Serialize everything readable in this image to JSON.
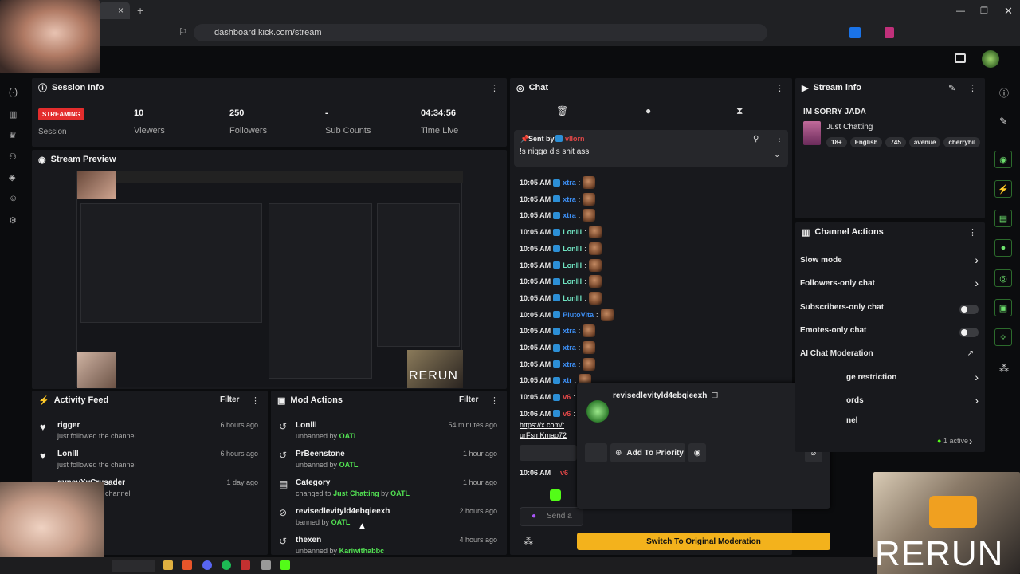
{
  "browser": {
    "url": "dashboard.kick.com/stream",
    "tab_close": "×",
    "tab_new": "+"
  },
  "session": {
    "title": "Session Info",
    "badge": "STREAMING",
    "session_label": "Session",
    "stats": [
      {
        "value": "10",
        "label": "Viewers"
      },
      {
        "value": "250",
        "label": "Followers"
      },
      {
        "value": "-",
        "label": "Sub Counts"
      },
      {
        "value": "04:34:56",
        "label": "Time Live"
      }
    ]
  },
  "preview": {
    "title": "Stream Preview",
    "rerun": "RERUN"
  },
  "activity": {
    "title": "Activity Feed",
    "filter": "Filter",
    "items": [
      {
        "name": "rigger",
        "desc": "just followed the channel",
        "time": "6 hours ago"
      },
      {
        "name": "Lonlll",
        "desc": "just followed the channel",
        "time": "6 hours ago"
      },
      {
        "name": "gypsyXvCrusader",
        "desc": "channel",
        "time": "1 day ago"
      }
    ]
  },
  "mod": {
    "title": "Mod Actions",
    "filter": "Filter",
    "items": [
      {
        "name": "Lonlll",
        "desc": "unbanned by",
        "by": "OATL",
        "time": "54 minutes ago"
      },
      {
        "name": "PrBeenstone",
        "desc": "unbanned by",
        "by": "OATL",
        "time": "1 hour ago"
      },
      {
        "name": "Category",
        "desc": "changed to",
        "cat": "Just Chatting",
        "by_word": "by",
        "by": "OATL",
        "time": "1 hour ago"
      },
      {
        "name": "revisedlevityld4ebqieexh",
        "desc": "banned by",
        "by": "OATL",
        "time": "2 hours ago"
      },
      {
        "name": "thexen",
        "desc": "unbanned by",
        "by": "Kariwithabbc",
        "time": "4 hours ago"
      }
    ]
  },
  "chat": {
    "title": "Chat",
    "pinned_by": "Sent by",
    "pinned_user": "vllorn",
    "pinned_msg": "!s nigga dis shit ass",
    "lines": [
      {
        "time": "10:05 AM",
        "user": "xtra",
        "color": "#3d8ef2"
      },
      {
        "time": "10:05 AM",
        "user": "xtra",
        "color": "#3d8ef2"
      },
      {
        "time": "10:05 AM",
        "user": "xtra",
        "color": "#3d8ef2"
      },
      {
        "time": "10:05 AM",
        "user": "Lonlll",
        "color": "#6fe3c1"
      },
      {
        "time": "10:05 AM",
        "user": "Lonlll",
        "color": "#6fe3c1"
      },
      {
        "time": "10:05 AM",
        "user": "Lonlll",
        "color": "#6fe3c1"
      },
      {
        "time": "10:05 AM",
        "user": "Lonlll",
        "color": "#6fe3c1"
      },
      {
        "time": "10:05 AM",
        "user": "Lonlll",
        "color": "#6fe3c1"
      },
      {
        "time": "10:05 AM",
        "user": "PlutoVita",
        "color": "#3d8ef2"
      },
      {
        "time": "10:05 AM",
        "user": "xtra",
        "color": "#3d8ef2"
      },
      {
        "time": "10:05 AM",
        "user": "xtra",
        "color": "#3d8ef2"
      },
      {
        "time": "10:05 AM",
        "user": "xtra",
        "color": "#3d8ef2"
      },
      {
        "time": "10:05 AM",
        "user": "xtr",
        "color": "#3d8ef2"
      },
      {
        "time": "10:05 AM",
        "user": "v6",
        "color": "#e24747"
      },
      {
        "time": "10:06 AM",
        "user": "v6",
        "color": "#e24747"
      }
    ],
    "link1": "https://x.com/t",
    "link2": "urFsmKmao72",
    "last_time": "10:06 AM",
    "send_placeholder": "Send a"
  },
  "popup": {
    "username": "revisedlevityld4ebqieexh",
    "priority_label": "Add To Priority",
    "switch_label": "Switch To Original Moderation"
  },
  "stream_info": {
    "title": "Stream info",
    "stream_title": "IM SORRY JADA",
    "category": "Just Chatting",
    "tags": [
      "18+",
      "English",
      "745",
      "avenue",
      "cherryhil"
    ]
  },
  "channel_actions": {
    "title": "Channel Actions",
    "items": [
      {
        "label": "Slow mode",
        "ctrl": "chev"
      },
      {
        "label": "Followers-only chat",
        "ctrl": "chev"
      },
      {
        "label": "Subscribers-only chat",
        "ctrl": "toggle"
      },
      {
        "label": "Emotes-only chat",
        "ctrl": "toggle"
      },
      {
        "label": "AI Chat Moderation",
        "ctrl": "ext"
      },
      {
        "label": "ge restriction",
        "ctrl": "chev"
      },
      {
        "label": "ords",
        "ctrl": "chev"
      },
      {
        "label": "nel",
        "ctrl": "none"
      }
    ],
    "active": "1 active"
  },
  "cam_overlay": "RERUN",
  "colors": {
    "accent": "#53fc18",
    "streaming": "#e32d2d",
    "switch_btn": "#f3b21c"
  }
}
